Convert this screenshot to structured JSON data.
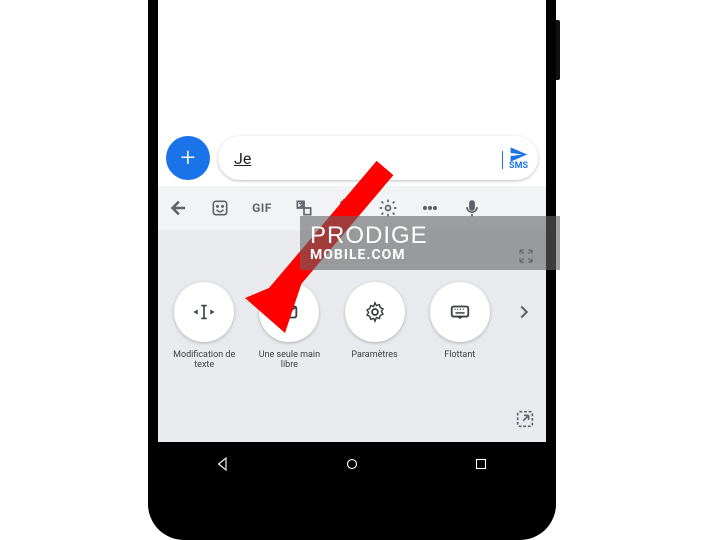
{
  "compose": {
    "input_value": "Je",
    "send_label_small": "SMS"
  },
  "toolbar": {
    "gif_label": "GIF"
  },
  "options": [
    {
      "id": "text-edit",
      "label": "Modification de texte"
    },
    {
      "id": "one-handed",
      "label": "Une seule main libre"
    },
    {
      "id": "settings",
      "label": "Paramètres"
    },
    {
      "id": "floating",
      "label": "Flottant"
    }
  ],
  "watermark": {
    "line1": "PRODIGE",
    "line2": "MOBILE.COM"
  }
}
